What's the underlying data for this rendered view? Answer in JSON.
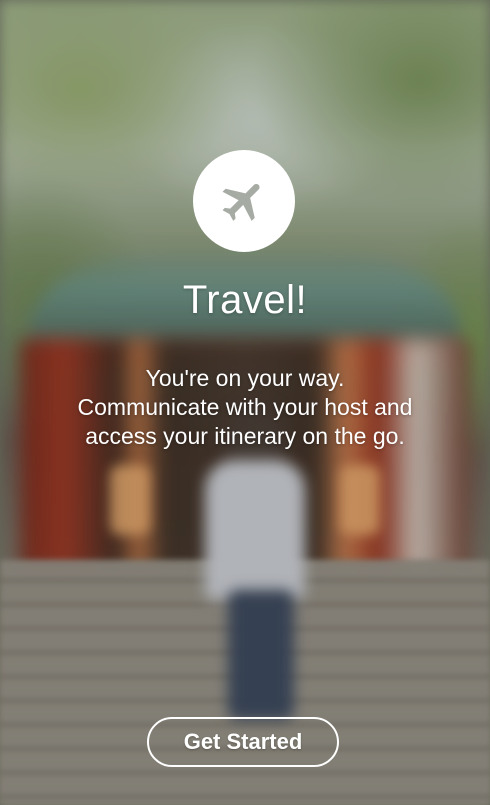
{
  "onboarding": {
    "icon": "airplane-icon",
    "title": "Travel!",
    "description_lines": [
      "You're on your way.",
      "Communicate with your host and",
      "access your itinerary on the go."
    ],
    "cta_label": "Get Started"
  },
  "colors": {
    "icon_fill": "#a6aba3",
    "icon_background": "#ffffff",
    "text": "#ffffff"
  }
}
